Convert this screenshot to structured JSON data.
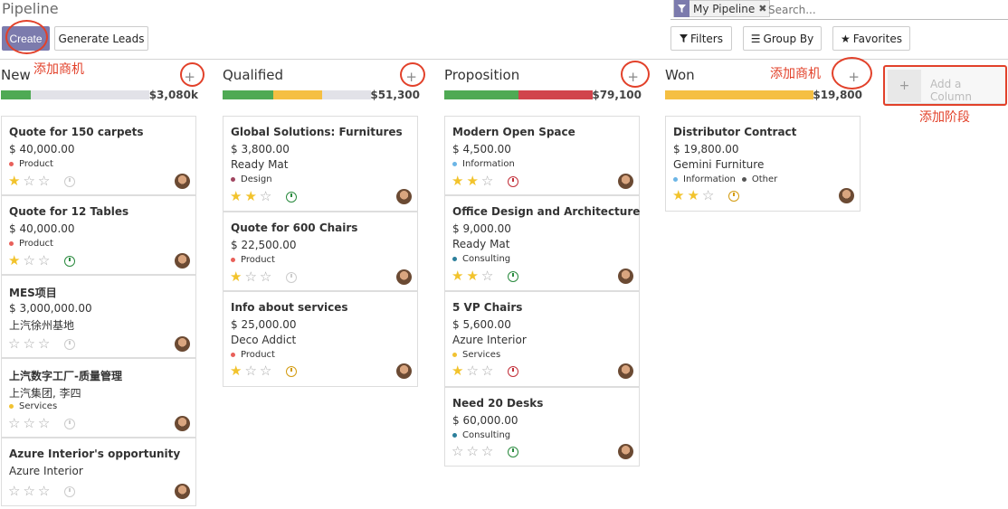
{
  "control_panel": {
    "title": "Pipeline",
    "create_label": "Create",
    "generate_leads_label": "Generate Leads",
    "search": {
      "facet_label": "My Pipeline",
      "facet_icon": "filter-icon",
      "placeholder": "Search..."
    },
    "filters_label": "Filters",
    "group_by_label": "Group By",
    "favorites_label": "Favorites"
  },
  "columns": [
    {
      "title": "New",
      "total": "$3,080k",
      "progress": {
        "green": 0.2,
        "yellow": 0,
        "red": 0
      },
      "cards": [
        {
          "name": "Quote for 150 carpets",
          "amount": "$ 40,000.00",
          "sub": "",
          "tags": [
            {
              "label": "Product",
              "color": "#e8605a"
            }
          ],
          "stars": 1,
          "activity": "grey"
        },
        {
          "name": "Quote for 12 Tables",
          "amount": "$ 40,000.00",
          "sub": "",
          "tags": [
            {
              "label": "Product",
              "color": "#e8605a"
            }
          ],
          "stars": 1,
          "activity": "green"
        },
        {
          "name": "MES项目",
          "amount": "$ 3,000,000.00",
          "sub": "上汽徐州基地",
          "tags": [],
          "stars": 0,
          "activity": "grey"
        },
        {
          "name": "上汽数字工厂-质量管理",
          "amount": "",
          "sub": "上汽集团, 李四",
          "tags": [
            {
              "label": "Services",
              "color": "#f1c232"
            }
          ],
          "stars": 0,
          "activity": "grey"
        },
        {
          "name": "Azure Interior's opportunity",
          "amount": "",
          "sub": "Azure Interior",
          "tags": [],
          "stars": 0,
          "activity": "grey"
        }
      ]
    },
    {
      "title": "Qualified",
      "total": "$51,300",
      "progress": {
        "green": 0.34,
        "yellow": 0.33,
        "red": 0
      },
      "cards": [
        {
          "name": "Global Solutions: Furnitures",
          "amount": "$ 3,800.00",
          "sub": "Ready Mat",
          "tags": [
            {
              "label": "Design",
              "color": "#a04560"
            }
          ],
          "stars": 2,
          "activity": "green"
        },
        {
          "name": "Quote for 600 Chairs",
          "amount": "$ 22,500.00",
          "sub": "",
          "tags": [
            {
              "label": "Product",
              "color": "#e8605a"
            }
          ],
          "stars": 1,
          "activity": "grey"
        },
        {
          "name": "Info about services",
          "amount": "$ 25,000.00",
          "sub": "Deco Addict",
          "tags": [
            {
              "label": "Product",
              "color": "#e8605a"
            }
          ],
          "stars": 1,
          "activity": "orange"
        }
      ]
    },
    {
      "title": "Proposition",
      "total": "$79,100",
      "progress": {
        "green": 0.5,
        "yellow": 0,
        "red": 0.5
      },
      "cards": [
        {
          "name": "Modern Open Space",
          "amount": "$ 4,500.00",
          "sub": "",
          "tags": [
            {
              "label": "Information",
              "color": "#6cb5e6"
            }
          ],
          "stars": 2,
          "activity": "red"
        },
        {
          "name": "Office Design and Architecture",
          "amount": "$ 9,000.00",
          "sub": "Ready Mat",
          "tags": [
            {
              "label": "Consulting",
              "color": "#2c7f9b"
            }
          ],
          "stars": 2,
          "activity": "green"
        },
        {
          "name": "5 VP Chairs",
          "amount": "$ 5,600.00",
          "sub": "Azure Interior",
          "tags": [
            {
              "label": "Services",
              "color": "#f1c232"
            }
          ],
          "stars": 1,
          "activity": "red"
        },
        {
          "name": "Need 20 Desks",
          "amount": "$ 60,000.00",
          "sub": "",
          "tags": [
            {
              "label": "Consulting",
              "color": "#2c7f9b"
            }
          ],
          "stars": 0,
          "activity": "green"
        }
      ]
    },
    {
      "title": "Won",
      "total": "$19,800",
      "progress": {
        "green": 0,
        "yellow": 1,
        "red": 0
      },
      "cards": [
        {
          "name": "Distributor Contract",
          "amount": "$ 19,800.00",
          "sub": "Gemini Furniture",
          "tags": [
            {
              "label": "Information",
              "color": "#6cb5e6"
            },
            {
              "label": "Other",
              "color": "#555555"
            }
          ],
          "stars": 2,
          "activity": "orange"
        }
      ]
    }
  ],
  "add_column": {
    "label": "Add a Column"
  },
  "annotations": {
    "add_opportunity": "添加商机",
    "add_stage": "添加阶段"
  },
  "colors": {
    "accent": "#7c7bad",
    "annotation": "#e2412a"
  }
}
